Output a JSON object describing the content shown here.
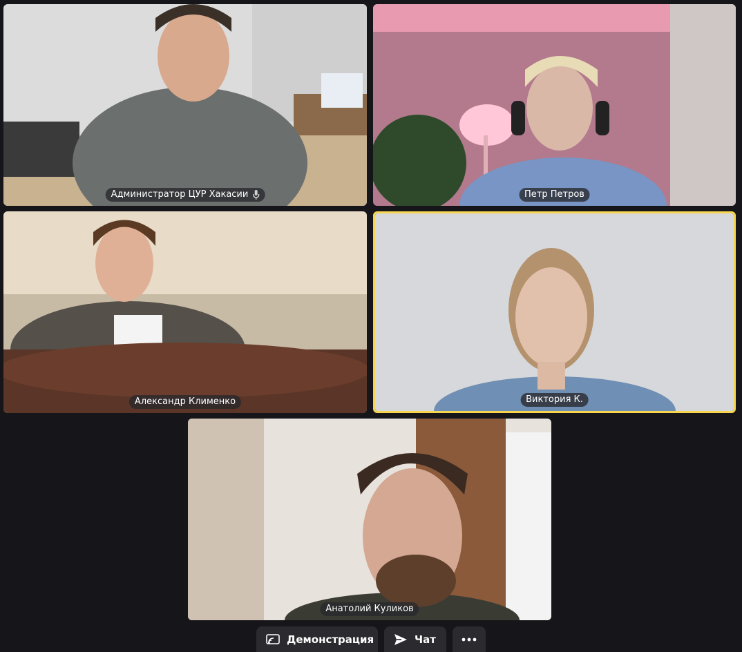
{
  "participants": [
    {
      "name": "Администратор ЦУР Хакасии",
      "mic_icon": "microphone-icon",
      "active_speaker": false
    },
    {
      "name": "Петр Петров",
      "active_speaker": false
    },
    {
      "name": "Александр Клименко",
      "active_speaker": false
    },
    {
      "name": "Виктория К.",
      "active_speaker": true
    },
    {
      "name": "Анатолий Куликов",
      "active_speaker": false
    }
  ],
  "toolbar": {
    "screen_share_label": "Демонстрация",
    "screen_share_icon": "screen-share-icon",
    "chat_label": "Чат",
    "chat_icon": "send-icon",
    "more_icon": "more-dots-icon"
  },
  "colors": {
    "background": "#16161a",
    "active_speaker_border": "#f7d54f",
    "button_bg": "#2a2a2f"
  }
}
